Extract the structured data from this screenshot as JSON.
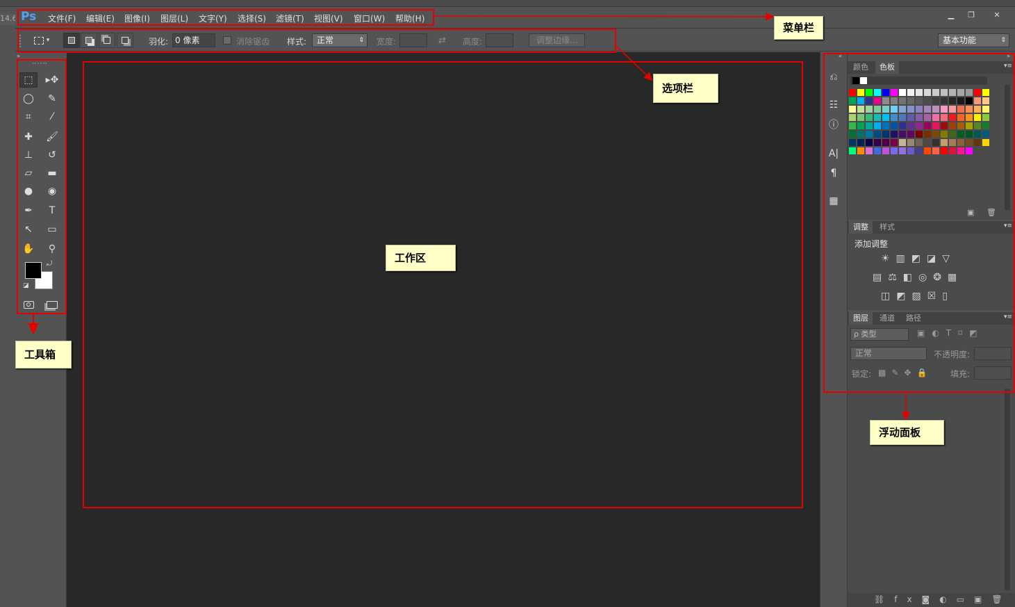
{
  "app": {
    "logo": "Ps",
    "zoom_fragment": "14.6"
  },
  "menus": [
    "文件(F)",
    "编辑(E)",
    "图像(I)",
    "图层(L)",
    "文字(Y)",
    "选择(S)",
    "滤镜(T)",
    "视图(V)",
    "窗口(W)",
    "帮助(H)"
  ],
  "window_controls": [
    "minimize",
    "restore",
    "close"
  ],
  "options": {
    "feather_label": "羽化:",
    "feather_value": "0 像素",
    "antialias_label": "消除锯齿",
    "style_label": "样式:",
    "style_value": "正常",
    "width_label": "宽度:",
    "height_label": "高度:",
    "refine_button": "调整边缘...",
    "workspace_value": "基本功能"
  },
  "panels": {
    "swatches": {
      "tabs": [
        "颜色",
        "色板"
      ],
      "active": "色板"
    },
    "adjustments": {
      "tabs": [
        "调整",
        "样式"
      ],
      "active": "调整",
      "title": "添加调整"
    },
    "layers": {
      "tabs": [
        "图层",
        "通道",
        "路径"
      ],
      "active": "图层",
      "filter_label": "ρ 类型",
      "blend_mode": "正常",
      "opacity_label": "不透明度:",
      "lock_label": "锁定:",
      "fill_label": "填充:"
    }
  },
  "annotations": {
    "menubar": "菜单栏",
    "optionsbar": "选项栏",
    "workarea": "工作区",
    "toolbox": "工具箱",
    "panels": "浮动面板"
  },
  "colors": {
    "annotation_red": "#e60000",
    "callout_bg": "#ffffc8",
    "ui_gray": "#535353",
    "canvas": "#282828"
  },
  "swatch_rows": [
    [
      "#ff0000",
      "#ffff00",
      "#00ff00",
      "#00ffff",
      "#0000ff",
      "#ff00ff",
      "#ffffff",
      "#f2f2f2",
      "#e6e6e6",
      "#d9d9d9",
      "#cccccc",
      "#bfbfbf",
      "#b3b3b3",
      "#a6a6a6",
      "#999999",
      "#ff0000",
      "#ffff00"
    ],
    [
      "#00a651",
      "#00aeef",
      "#2e3192",
      "#ec008c",
      "#8c8c8c",
      "#808080",
      "#737373",
      "#666666",
      "#595959",
      "#4d4d4d",
      "#404040",
      "#333333",
      "#262626",
      "#1a1a1a",
      "#000000",
      "#f7977a",
      "#fdc68a"
    ],
    [
      "#fff799",
      "#c4df9b",
      "#a2d39c",
      "#82ca9d",
      "#7bcdc8",
      "#6ecff6",
      "#7ea7d8",
      "#8493ca",
      "#8882be",
      "#a187be",
      "#bc8dbf",
      "#f49ac2",
      "#f6989d",
      "#f26c4f",
      "#f68e55",
      "#fbaf5c",
      "#fff467"
    ],
    [
      "#acd372",
      "#7cc576",
      "#3bb878",
      "#1abbb4",
      "#00bff3",
      "#438ccb",
      "#5574b9",
      "#605ca8",
      "#855fa8",
      "#a763a8",
      "#f06ea9",
      "#f26d7d",
      "#ed1c24",
      "#f26522",
      "#f7941d",
      "#fff200",
      "#8dc73f"
    ],
    [
      "#39b54a",
      "#00a651",
      "#00a99d",
      "#00aeef",
      "#0072bc",
      "#0054a6",
      "#2e3192",
      "#662d91",
      "#92278f",
      "#9e005d",
      "#ed145b",
      "#9e0b0f",
      "#a0410d",
      "#a36209",
      "#aba000",
      "#598527",
      "#197b30"
    ],
    [
      "#007236",
      "#00746b",
      "#0076a3",
      "#004a80",
      "#003471",
      "#1b1464",
      "#440e62",
      "#630460",
      "#790000",
      "#7b2e00",
      "#7d4900",
      "#827b00",
      "#406618",
      "#005e20",
      "#005826",
      "#005952",
      "#005b7f"
    ],
    [
      "#003663",
      "#002157",
      "#0d004c",
      "#32004b",
      "#4b0049",
      "#7b0046",
      "#c7b299",
      "#998675",
      "#736357",
      "#534741",
      "#37302d",
      "#c69c6d",
      "#a67c52",
      "#8c6239",
      "#754c24",
      "#603913",
      "#ffd700"
    ],
    [
      "#00ff7f",
      "#ff8c00",
      "#da70d6",
      "#4169e1",
      "#ba55d3",
      "#7b68ee",
      "#9370db",
      "#6a5acd",
      "#483d8b",
      "#ff4500",
      "#ff6347",
      "#ff0000",
      "#dc143c",
      "#ff1493",
      "#ff00ff"
    ]
  ]
}
